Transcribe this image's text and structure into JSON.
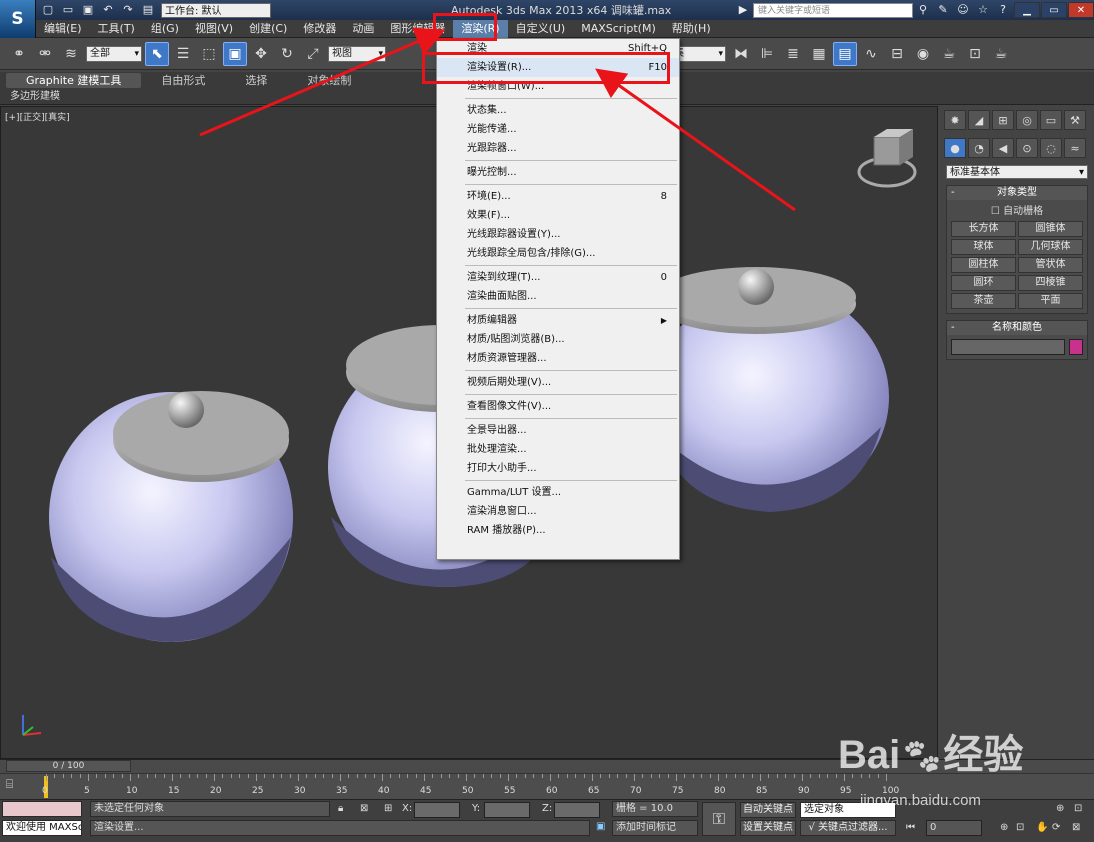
{
  "app": {
    "logo": "S",
    "workspace": "工作台: 默认",
    "title": "Autodesk 3ds Max  2013 x64     调味罐.max",
    "search_placeholder": "键入关键字或短语"
  },
  "menu": [
    "编辑(E)",
    "工具(T)",
    "组(G)",
    "视图(V)",
    "创建(C)",
    "修改器",
    "动画",
    "图形编辑器",
    "渲染(R)",
    "自定义(U)",
    "MAXScript(M)",
    "帮助(H)"
  ],
  "toolbar": {
    "filter": "全部",
    "ref_coord": "视图",
    "named_sel": "建集"
  },
  "ribbon": {
    "tabs": [
      "Graphite 建模工具",
      "自由形式",
      "选择",
      "对象绘制"
    ],
    "sub": "多边形建模"
  },
  "viewport": {
    "label": "[+][正交][真实]"
  },
  "render_menu": [
    {
      "label": "渲染",
      "shortcut": "Shift+Q"
    },
    {
      "label": "渲染设置(R)...",
      "shortcut": "F10"
    },
    {
      "label": "渲染帧窗口(W)...",
      "shortcut": ""
    },
    {
      "sep": true
    },
    {
      "label": "状态集...",
      "shortcut": ""
    },
    {
      "label": "光能传递...",
      "shortcut": ""
    },
    {
      "label": "光跟踪器...",
      "shortcut": ""
    },
    {
      "sep": true
    },
    {
      "label": "曝光控制...",
      "shortcut": ""
    },
    {
      "sep": true
    },
    {
      "label": "环境(E)...",
      "shortcut": "8"
    },
    {
      "label": "效果(F)...",
      "shortcut": ""
    },
    {
      "label": "光线跟踪器设置(Y)...",
      "shortcut": ""
    },
    {
      "label": "光线跟踪全局包含/排除(G)...",
      "shortcut": ""
    },
    {
      "sep": true
    },
    {
      "label": "渲染到纹理(T)...",
      "shortcut": "0"
    },
    {
      "label": "渲染曲面贴图...",
      "shortcut": ""
    },
    {
      "sep": true
    },
    {
      "label": "材质编辑器",
      "shortcut": "",
      "submenu": true
    },
    {
      "label": "材质/贴图浏览器(B)...",
      "shortcut": ""
    },
    {
      "label": "材质资源管理器...",
      "shortcut": ""
    },
    {
      "sep": true
    },
    {
      "label": "视频后期处理(V)...",
      "shortcut": ""
    },
    {
      "sep": true
    },
    {
      "label": "查看图像文件(V)...",
      "shortcut": ""
    },
    {
      "sep": true
    },
    {
      "label": "全景导出器...",
      "shortcut": ""
    },
    {
      "label": "批处理渲染...",
      "shortcut": ""
    },
    {
      "label": "打印大小助手...",
      "shortcut": ""
    },
    {
      "sep": true
    },
    {
      "label": "Gamma/LUT 设置...",
      "shortcut": ""
    },
    {
      "label": "渲染消息窗口...",
      "shortcut": ""
    },
    {
      "label": "RAM 播放器(P)...",
      "shortcut": ""
    }
  ],
  "command_panel": {
    "category": "标准基本体",
    "object_type_title": "对象类型",
    "autogrid": "自动栅格",
    "primitives": [
      "长方体",
      "圆锥体",
      "球体",
      "几何球体",
      "圆柱体",
      "管状体",
      "圆环",
      "四棱锥",
      "茶壶",
      "平面"
    ],
    "name_color_title": "名称和颜色",
    "color": "#c8318c"
  },
  "timeline": {
    "slider": "0 / 100",
    "ticks": [
      "0",
      "5",
      "10",
      "15",
      "20",
      "25",
      "30",
      "35",
      "40",
      "45",
      "50",
      "55",
      "60",
      "65",
      "70",
      "75",
      "80",
      "85",
      "90",
      "95",
      "100"
    ]
  },
  "status": {
    "welcome": "欢迎使用 MAXSc",
    "selection": "未选定任何对象",
    "prompt": "渲染设置...",
    "x_label": "X:",
    "y_label": "Y:",
    "z_label": "Z:",
    "grid": "栅格 = 10.0",
    "add_tag": "添加时间标记",
    "auto_key": "自动关键点",
    "set_key": "设置关键点",
    "selected": "选定对象",
    "key_filters": "关键点过滤器...",
    "frame": "0"
  },
  "watermark": {
    "brand": "Bai",
    "brand2": "经验",
    "url": "jingyan.baidu.com"
  }
}
